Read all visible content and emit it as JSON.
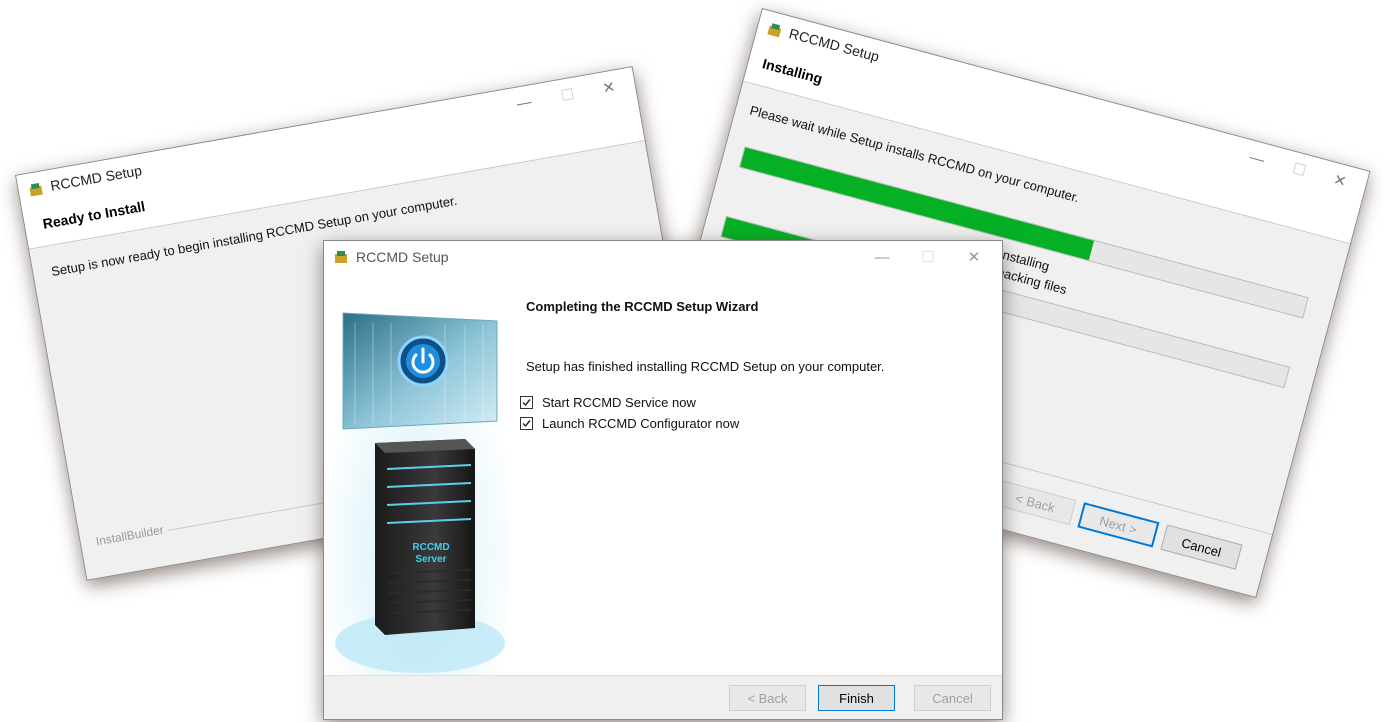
{
  "colors": {
    "progress": "#06b025",
    "focus_border": "#0078d7",
    "footer_gray": "#f0f0f0"
  },
  "left_window": {
    "title": "RCCMD Setup",
    "step_title": "Ready to Install",
    "message": "Setup is now ready to begin installing RCCMD Setup on your computer.",
    "branding": "InstallBuilder",
    "controls": {
      "minimize": "—",
      "maximize": "☐",
      "close": "✕"
    }
  },
  "right_window": {
    "title": "RCCMD Setup",
    "step_title": "Installing",
    "message": "Please wait while Setup installs RCCMD on your computer.",
    "status_line_1": "Installing",
    "status_line_2": "Unpacking files",
    "progress_1": 0.62,
    "progress_2": 0.24,
    "buttons": {
      "back": "< Back",
      "next": "Next >",
      "cancel": "Cancel"
    },
    "controls": {
      "minimize": "—",
      "maximize": "☐",
      "close": "✕"
    }
  },
  "center_window": {
    "title": "RCCMD Setup",
    "heading": "Completing the RCCMD Setup Wizard",
    "message": "Setup has finished installing RCCMD Setup on your computer.",
    "options": [
      {
        "label": "Start RCCMD Service now",
        "checked": true
      },
      {
        "label": "Launch RCCMD Configurator now",
        "checked": true
      }
    ],
    "server_label_1": "RCCMD",
    "server_label_2": "Server",
    "buttons": {
      "back": "< Back",
      "finish": "Finish",
      "cancel": "Cancel"
    },
    "controls": {
      "minimize": "—",
      "maximize": "☐",
      "close": "✕"
    }
  }
}
